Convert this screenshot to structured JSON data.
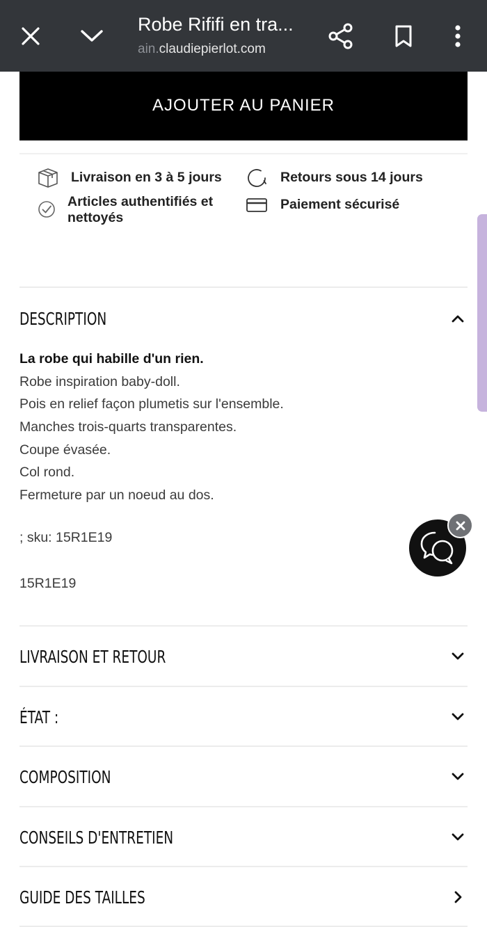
{
  "browser": {
    "title": "Robe Rififi en tra...",
    "url_faded": "ain.",
    "url": "claudiepierlot.com",
    "icons": [
      "close-icon",
      "chevron-down-icon",
      "share-icon",
      "bookmark-icon",
      "more-vert-icon"
    ]
  },
  "product": {
    "add_to_cart": "AJOUTER AU PANIER"
  },
  "features": [
    {
      "icon": "box-icon",
      "label": "Livraison en 3 à 5 jours"
    },
    {
      "icon": "return-icon",
      "label": "Retours sous 14 jours"
    },
    {
      "icon": "check-icon",
      "label_line1": "Articles authentifiés et",
      "label_line2": "nettoyés"
    },
    {
      "icon": "card-icon",
      "label": "Paiement sécurisé"
    }
  ],
  "description": {
    "title": "DESCRIPTION",
    "lead": "La robe qui habille d'un rien.",
    "lines": [
      "Robe inspiration baby-doll.",
      "Pois en relief façon plumetis sur l'ensemble.",
      "Manches trois-quarts transparentes.",
      "Coupe évasée.",
      "Col rond.",
      "Fermeture par un noeud au dos."
    ],
    "sku_line": "; sku: 15R1E19",
    "sku": "15R1E19"
  },
  "sections": [
    {
      "title": "LIVRAISON ET RETOUR",
      "caret": "chevron-down-icon"
    },
    {
      "title": "ÉTAT :",
      "caret": "chevron-down-icon"
    },
    {
      "title": "COMPOSITION",
      "caret": "chevron-down-icon"
    },
    {
      "title": "CONSEILS D'ENTRETIEN",
      "caret": "chevron-down-icon"
    },
    {
      "title": "GUIDE DES TAILLES",
      "caret": "chevron-right-icon"
    }
  ],
  "chat": {
    "icon": "chat-bubbles-icon",
    "close_icon": "close-icon"
  },
  "colors": {
    "topbar": "#33363a",
    "cta": "#000000",
    "chat": "#111111",
    "scroll_tab": "#c6b3dd"
  }
}
